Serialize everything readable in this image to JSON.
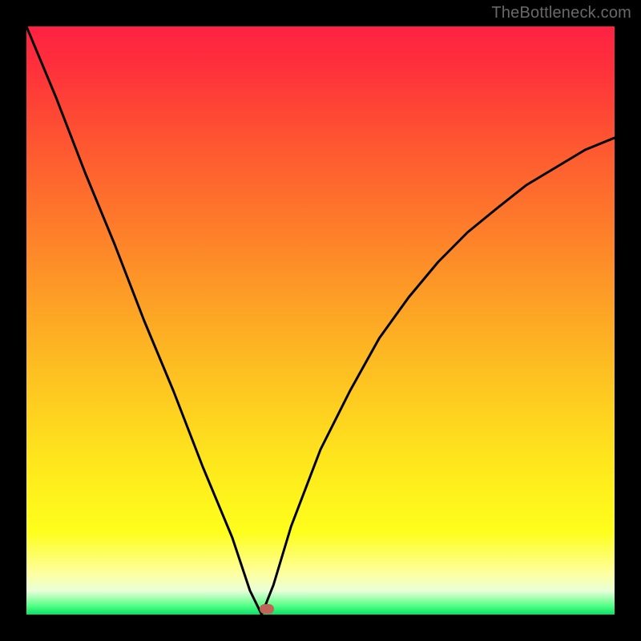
{
  "watermark": "TheBottleneck.com",
  "colors": {
    "background": "#000000",
    "gradient_top": "#fe2242",
    "gradient_mid1": "#fd8d28",
    "gradient_mid2": "#fefe1c",
    "gradient_bottom": "#04e164",
    "curve": "#000000",
    "marker": "#c16357",
    "watermark": "#69696b"
  },
  "chart_data": {
    "type": "line",
    "title": "",
    "xlabel": "",
    "ylabel": "",
    "xlim": [
      0,
      100
    ],
    "ylim": [
      0,
      100
    ],
    "note": "origin at bottom-left; y=bottleneck % (0=green, 100=red)",
    "minimum_at_x": 40,
    "series": [
      {
        "name": "bottleneck-curve",
        "x": [
          0,
          5,
          10,
          15,
          20,
          25,
          30,
          35,
          38,
          40,
          42,
          45,
          50,
          55,
          60,
          65,
          70,
          75,
          80,
          85,
          90,
          95,
          100
        ],
        "y": [
          100,
          88,
          75,
          63,
          50,
          38,
          25,
          13,
          4,
          0,
          5,
          15,
          28,
          38,
          47,
          54,
          60,
          65,
          69,
          73,
          76,
          79,
          81
        ]
      }
    ],
    "marker": {
      "x": 41,
      "y": 1
    }
  }
}
